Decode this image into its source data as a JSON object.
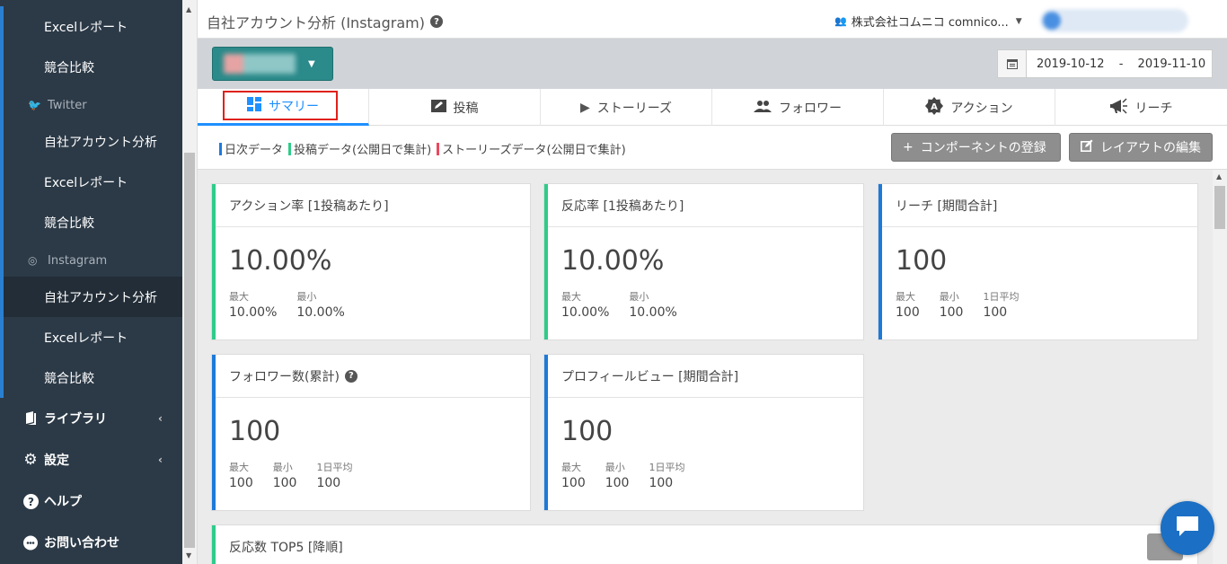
{
  "sidebar": {
    "items": [
      {
        "label": "Excelレポート"
      },
      {
        "label": "競合比較"
      },
      {
        "label": "Twitter"
      },
      {
        "label": "自社アカウント分析"
      },
      {
        "label": "Excelレポート"
      },
      {
        "label": "競合比較"
      },
      {
        "label": "Instagram"
      },
      {
        "label": "自社アカウント分析"
      },
      {
        "label": "Excelレポート"
      },
      {
        "label": "競合比較"
      },
      {
        "label": "ライブラリ"
      },
      {
        "label": "設定"
      },
      {
        "label": "ヘルプ"
      },
      {
        "label": "お問い合わせ"
      }
    ]
  },
  "header": {
    "title": "自社アカウント分析 (Instagram)",
    "company": "株式会社コムニコ comnico..."
  },
  "toolbar": {
    "date_start": "2019-10-12",
    "date_sep": "-",
    "date_end": "2019-11-10"
  },
  "tabs": [
    {
      "label": "サマリー",
      "icon": "dashboard-icon"
    },
    {
      "label": "投稿",
      "icon": "edit-icon"
    },
    {
      "label": "ストーリーズ",
      "icon": "play-icon"
    },
    {
      "label": "フォロワー",
      "icon": "people-icon"
    },
    {
      "label": "アクション",
      "icon": "action-icon"
    },
    {
      "label": "リーチ",
      "icon": "megaphone-icon"
    }
  ],
  "legend": [
    {
      "label": "日次データ",
      "color": "#1e7ad8"
    },
    {
      "label": "投稿データ(公開日で集計)",
      "color": "#2ecc8a"
    },
    {
      "label": "ストーリーズデータ(公開日で集計)",
      "color": "#e84a5f"
    }
  ],
  "actions": {
    "add_component": "コンポーネントの登録",
    "edit_layout": "レイアウトの編集"
  },
  "cards": [
    {
      "title": "アクション率 [1投稿あたり]",
      "value": "10.00%",
      "color": "#2ecc8a",
      "stats": [
        {
          "label": "最大",
          "value": "10.00%"
        },
        {
          "label": "最小",
          "value": "10.00%"
        }
      ]
    },
    {
      "title": "反応率 [1投稿あたり]",
      "value": "10.00%",
      "color": "#2ecc8a",
      "stats": [
        {
          "label": "最大",
          "value": "10.00%"
        },
        {
          "label": "最小",
          "value": "10.00%"
        }
      ]
    },
    {
      "title": "リーチ [期間合計]",
      "value": "100",
      "color": "#1e7ad8",
      "stats": [
        {
          "label": "最大",
          "value": "100"
        },
        {
          "label": "最小",
          "value": "100"
        },
        {
          "label": "1日平均",
          "value": "100"
        }
      ]
    },
    {
      "title": "フォロワー数(累計)",
      "value": "100",
      "color": "#1e7ad8",
      "stats": [
        {
          "label": "最大",
          "value": "100"
        },
        {
          "label": "最小",
          "value": "100"
        },
        {
          "label": "1日平均",
          "value": "100"
        }
      ]
    },
    {
      "title": "プロフィールビュー [期間合計]",
      "value": "100",
      "color": "#1e7ad8",
      "stats": [
        {
          "label": "最大",
          "value": "100"
        },
        {
          "label": "最小",
          "value": "100"
        },
        {
          "label": "1日平均",
          "value": "100"
        }
      ]
    },
    {
      "title": "反応数 TOP5 [降順]",
      "color": "#2ecc8a"
    }
  ]
}
